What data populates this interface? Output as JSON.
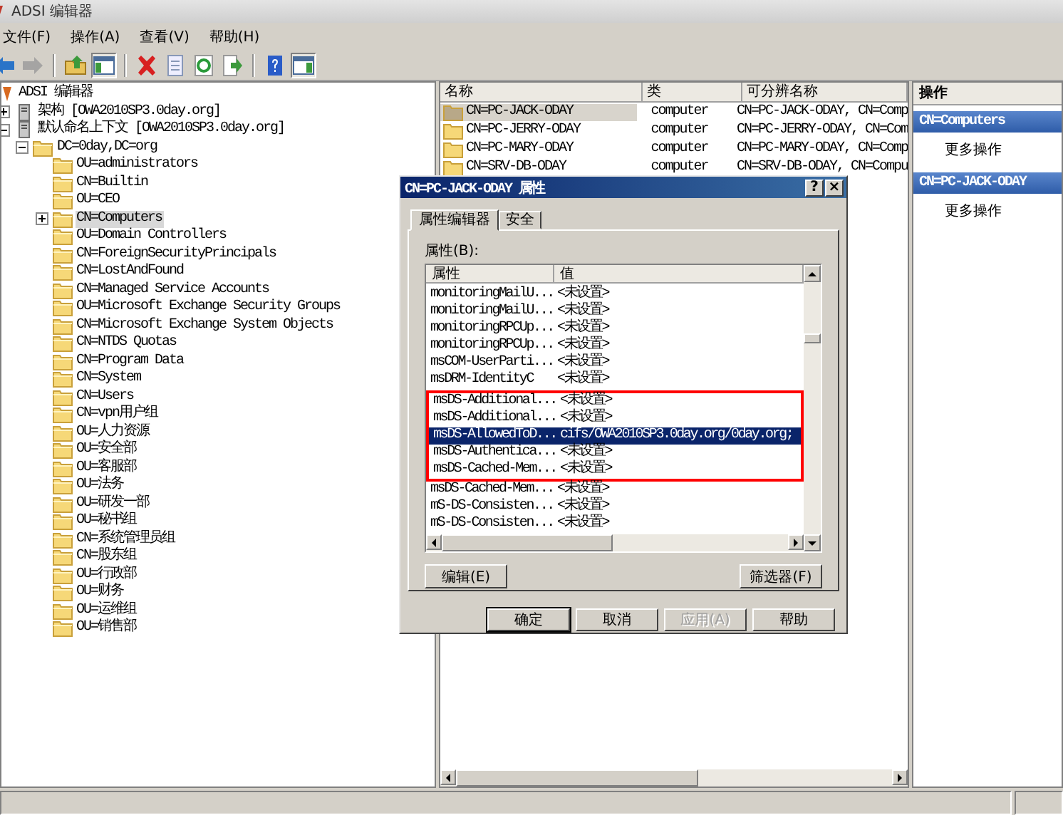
{
  "window": {
    "title": "ADSI 编辑器"
  },
  "menu": [
    "文件(F)",
    "操作(A)",
    "查看(V)",
    "帮助(H)"
  ],
  "toolbar_groups": [
    [
      {
        "kind": "back",
        "disabled": false,
        "pressed": false
      },
      {
        "kind": "forward",
        "disabled": true,
        "pressed": false
      }
    ],
    [
      {
        "kind": "up",
        "disabled": false,
        "pressed": false
      },
      {
        "kind": "tree-toggle",
        "disabled": false,
        "pressed": true
      }
    ],
    [
      {
        "kind": "delete",
        "disabled": false,
        "pressed": false
      },
      {
        "kind": "properties",
        "disabled": false,
        "pressed": false
      },
      {
        "kind": "refresh",
        "disabled": false,
        "pressed": false
      },
      {
        "kind": "export",
        "disabled": false,
        "pressed": false
      }
    ],
    [
      {
        "kind": "help",
        "disabled": false,
        "pressed": false
      },
      {
        "kind": "pane-toggle",
        "disabled": false,
        "pressed": true
      }
    ]
  ],
  "tree": {
    "label": "ADSI 编辑器",
    "kind": "root",
    "selected": false,
    "children": [
      {
        "label": "架构 [OWA2010SP3.0day.org]",
        "kind": "server",
        "expanded": false,
        "selected": false
      },
      {
        "label": "默认命名上下文 [OWA2010SP3.0day.org]",
        "kind": "server",
        "expanded": true,
        "selected": false,
        "children": [
          {
            "label": "DC=0day,DC=org",
            "kind": "folder",
            "expanded": true,
            "selected": false,
            "children": [
              {
                "label": "OU=administrators",
                "kind": "folder",
                "selected": false
              },
              {
                "label": "CN=Builtin",
                "kind": "folder",
                "selected": false
              },
              {
                "label": "OU=CEO",
                "kind": "folder",
                "selected": false
              },
              {
                "label": "CN=Computers",
                "kind": "folder",
                "expanded": false,
                "selected": true
              },
              {
                "label": "OU=Domain Controllers",
                "kind": "folder",
                "selected": false
              },
              {
                "label": "CN=ForeignSecurityPrincipals",
                "kind": "folder",
                "selected": false
              },
              {
                "label": "CN=LostAndFound",
                "kind": "folder",
                "selected": false
              },
              {
                "label": "CN=Managed Service Accounts",
                "kind": "folder",
                "selected": false
              },
              {
                "label": "OU=Microsoft Exchange Security Groups",
                "kind": "folder",
                "selected": false
              },
              {
                "label": "CN=Microsoft Exchange System Objects",
                "kind": "folder",
                "selected": false
              },
              {
                "label": "CN=NTDS Quotas",
                "kind": "folder",
                "selected": false
              },
              {
                "label": "CN=Program Data",
                "kind": "folder",
                "selected": false
              },
              {
                "label": "CN=System",
                "kind": "folder",
                "selected": false
              },
              {
                "label": "CN=Users",
                "kind": "folder",
                "selected": false
              },
              {
                "label": "CN=vpn用户组",
                "kind": "folder",
                "selected": false
              },
              {
                "label": "OU=人力资源",
                "kind": "folder",
                "selected": false
              },
              {
                "label": "OU=安全部",
                "kind": "folder",
                "selected": false
              },
              {
                "label": "OU=客服部",
                "kind": "folder",
                "selected": false
              },
              {
                "label": "OU=法务",
                "kind": "folder",
                "selected": false
              },
              {
                "label": "OU=研发一部",
                "kind": "folder",
                "selected": false
              },
              {
                "label": "OU=秘书组",
                "kind": "folder",
                "selected": false
              },
              {
                "label": "CN=系统管理员组",
                "kind": "folder",
                "selected": false
              },
              {
                "label": "CN=股东组",
                "kind": "folder",
                "selected": false
              },
              {
                "label": "OU=行政部",
                "kind": "folder",
                "selected": false
              },
              {
                "label": "OU=财务",
                "kind": "folder",
                "selected": false
              },
              {
                "label": "OU=运维组",
                "kind": "folder",
                "selected": false
              },
              {
                "label": "OU=销售部",
                "kind": "folder",
                "selected": false
              }
            ]
          }
        ]
      }
    ]
  },
  "list": {
    "columns": [
      "名称",
      "类",
      "可分辨名称"
    ],
    "rows": [
      {
        "name": "CN=PC-JACK-ODAY",
        "class": "computer",
        "dn": "CN=PC-JACK-ODAY, CN=Comp",
        "selected": true
      },
      {
        "name": "CN=PC-JERRY-ODAY",
        "class": "computer",
        "dn": "CN=PC-JERRY-ODAY, CN=Com",
        "selected": false
      },
      {
        "name": "CN=PC-MARY-ODAY",
        "class": "computer",
        "dn": "CN=PC-MARY-ODAY, CN=Comp",
        "selected": false
      },
      {
        "name": "CN=SRV-DB-ODAY",
        "class": "computer",
        "dn": "CN=SRV-DB-ODAY, CN=Compu",
        "selected": false
      }
    ]
  },
  "actions": {
    "title": "操作",
    "sections": [
      {
        "header": "CN=Computers",
        "items": [
          "更多操作"
        ]
      },
      {
        "header": "CN=PC-JACK-ODAY",
        "items": [
          "更多操作"
        ]
      }
    ]
  },
  "dialog": {
    "title": "CN=PC-JACK-ODAY 属性",
    "title_buttons": [
      "?",
      "×"
    ],
    "tabs": [
      {
        "label": "属性编辑器",
        "selected": true
      },
      {
        "label": "安全",
        "selected": false
      }
    ],
    "list_label": "属性(B):",
    "columns": [
      "属性",
      "值"
    ],
    "rows": [
      {
        "attribute": "monitoringMailU...",
        "value": "<未设置>",
        "selected": false,
        "highlighted": false
      },
      {
        "attribute": "monitoringMailU...",
        "value": "<未设置>",
        "selected": false,
        "highlighted": false
      },
      {
        "attribute": "monitoringRPCUp...",
        "value": "<未设置>",
        "selected": false,
        "highlighted": false
      },
      {
        "attribute": "monitoringRPCUp...",
        "value": "<未设置>",
        "selected": false,
        "highlighted": false
      },
      {
        "attribute": "msCOM-UserParti...",
        "value": "<未设置>",
        "selected": false,
        "highlighted": false
      },
      {
        "attribute": "msDRM-IdentityC",
        "value": "<未设置>",
        "selected": false,
        "highlighted": false
      },
      {
        "attribute": "msDS-Additional...",
        "value": "<未设置>",
        "selected": false,
        "highlighted": true
      },
      {
        "attribute": "msDS-Additional...",
        "value": "<未设置>",
        "selected": false,
        "highlighted": true
      },
      {
        "attribute": "msDS-AllowedToD...",
        "value": "cifs/OWA2010SP3.0day.org/0day.org;",
        "selected": true,
        "highlighted": true
      },
      {
        "attribute": "msDS-Authentica...",
        "value": "<未设置>",
        "selected": false,
        "highlighted": true
      },
      {
        "attribute": "msDS-Cached-Mem...",
        "value": "<未设置>",
        "selected": false,
        "highlighted": true
      },
      {
        "attribute": "msDS-Cached-Mem...",
        "value": "<未设置>",
        "selected": false,
        "highlighted": false
      },
      {
        "attribute": "mS-DS-Consisten...",
        "value": "<未设置>",
        "selected": false,
        "highlighted": false
      },
      {
        "attribute": "mS-DS-Consisten...",
        "value": "<未设置>",
        "selected": false,
        "highlighted": false
      }
    ],
    "list_buttons": [
      "编辑(E)",
      "筛选器(F)"
    ],
    "footer_buttons": [
      {
        "label": "确定",
        "default": true,
        "disabled": false
      },
      {
        "label": "取消",
        "default": false,
        "disabled": false
      },
      {
        "label": "应用(A)",
        "default": false,
        "disabled": true
      },
      {
        "label": "帮助",
        "default": false,
        "disabled": false
      }
    ]
  }
}
